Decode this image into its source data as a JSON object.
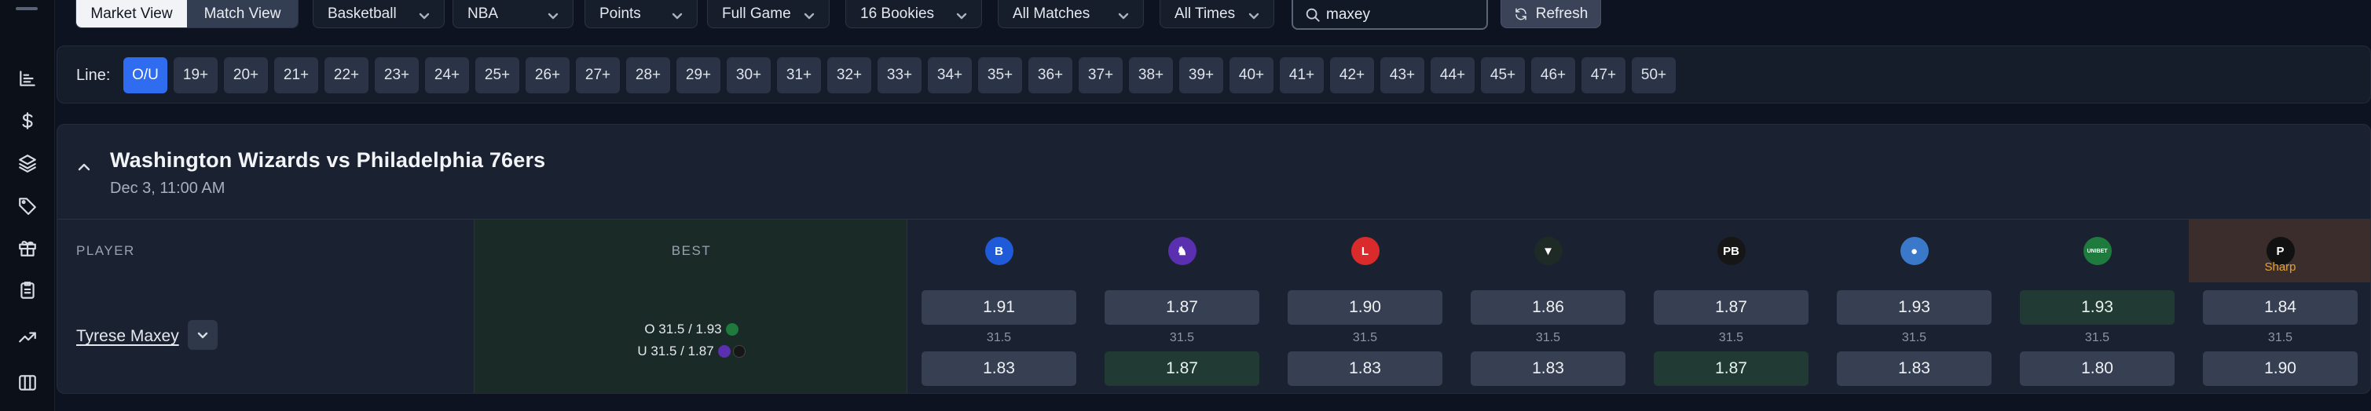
{
  "sidebar": {
    "icons": [
      "chart-bars-icon",
      "dollar-icon",
      "layers-icon",
      "tag-icon",
      "gift-icon",
      "clipboard-icon",
      "trending-up-icon",
      "columns-icon"
    ]
  },
  "filters": {
    "view_toggle": [
      "Market View",
      "Match View"
    ],
    "active_view": "Market View",
    "sport": "Basketball",
    "league": "NBA",
    "market": "Points",
    "period": "Full Game",
    "bookies": "16 Bookies",
    "matches": "All Matches",
    "times": "All Times",
    "search_value": "maxey",
    "refresh_label": "Refresh"
  },
  "line_selector": {
    "label": "Line:",
    "options": [
      "O/U",
      "19+",
      "20+",
      "21+",
      "22+",
      "23+",
      "24+",
      "25+",
      "26+",
      "27+",
      "28+",
      "29+",
      "30+",
      "31+",
      "32+",
      "33+",
      "34+",
      "35+",
      "36+",
      "37+",
      "38+",
      "39+",
      "40+",
      "41+",
      "42+",
      "43+",
      "44+",
      "45+",
      "46+",
      "47+",
      "50+"
    ],
    "active": "O/U"
  },
  "match": {
    "title": "Washington Wizards vs Philadelphia 76ers",
    "time": "Dec 3, 11:00 AM",
    "header_player": "PLAYER",
    "header_best": "BEST",
    "player": {
      "name": "Tyrese Maxey",
      "best_over": "O 31.5 / 1.93",
      "best_under": "U 31.5 / 1.87"
    },
    "books": [
      {
        "logo": "B",
        "color": "#1f5bd8",
        "over": "1.91",
        "line": "31.5",
        "under": "1.83",
        "over_hl": false,
        "under_hl": false
      },
      {
        "logo": "♞",
        "color": "#5a2fb0",
        "over": "1.87",
        "line": "31.5",
        "under": "1.87",
        "over_hl": false,
        "under_hl": true
      },
      {
        "logo": "L",
        "color": "#d92b2b",
        "over": "1.90",
        "line": "31.5",
        "under": "1.83",
        "over_hl": false,
        "under_hl": false
      },
      {
        "logo": "▼",
        "color": "#1e2a26",
        "over": "1.86",
        "line": "31.5",
        "under": "1.83",
        "over_hl": false,
        "under_hl": false
      },
      {
        "logo": "PB",
        "color": "#161616",
        "over": "1.87",
        "line": "31.5",
        "under": "1.87",
        "over_hl": false,
        "under_hl": true
      },
      {
        "logo": "●",
        "color": "#3a78c9",
        "over": "1.93",
        "line": "31.5",
        "under": "1.83",
        "over_hl": false,
        "under_hl": false
      },
      {
        "logo": "UNIBET",
        "color": "#1f7a3d",
        "over": "1.93",
        "line": "31.5",
        "under": "1.80",
        "over_hl": true,
        "under_hl": false
      },
      {
        "logo": "P",
        "color": "#111111",
        "over": "1.84",
        "line": "31.5",
        "under": "1.90",
        "over_hl": false,
        "under_hl": false,
        "sharp_label": "Sharp"
      }
    ]
  }
}
